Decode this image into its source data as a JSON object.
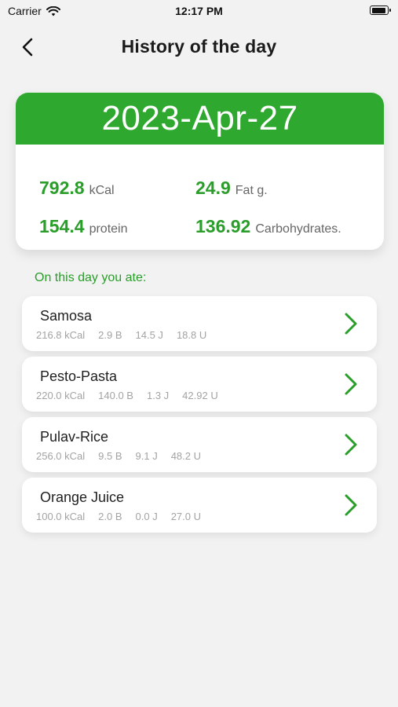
{
  "status_bar": {
    "carrier": "Carrier",
    "time": "12:17 PM"
  },
  "header": {
    "title": "History of the day",
    "back_icon": "chevron-left-icon"
  },
  "summary": {
    "date": "2023-Apr-27",
    "kcal_value": "792.8",
    "kcal_unit": "kCal",
    "fat_value": "24.9",
    "fat_unit": "Fat g.",
    "protein_value": "154.4",
    "protein_unit": "protein",
    "carbs_value": "136.92",
    "carbs_unit": "Carbohydrates."
  },
  "section_label": "On this day you ate:",
  "foods": [
    {
      "name": "Samosa",
      "macros": [
        "216.8 kCal",
        "2.9 B",
        "14.5 J",
        "18.8 U"
      ]
    },
    {
      "name": "Pesto-Pasta",
      "macros": [
        "220.0 kCal",
        "140.0 B",
        "1.3 J",
        "42.92 U"
      ]
    },
    {
      "name": "Pulav-Rice",
      "macros": [
        "256.0 kCal",
        "9.5 B",
        "9.1 J",
        "48.2 U"
      ]
    },
    {
      "name": "Orange Juice",
      "macros": [
        "100.0 kCal",
        "2.0 B",
        "0.0 J",
        "27.0 U"
      ]
    }
  ],
  "colors": {
    "accent": "#2ea82e",
    "accent_text": "#2a9d2a",
    "background": "#f2f2f2"
  }
}
